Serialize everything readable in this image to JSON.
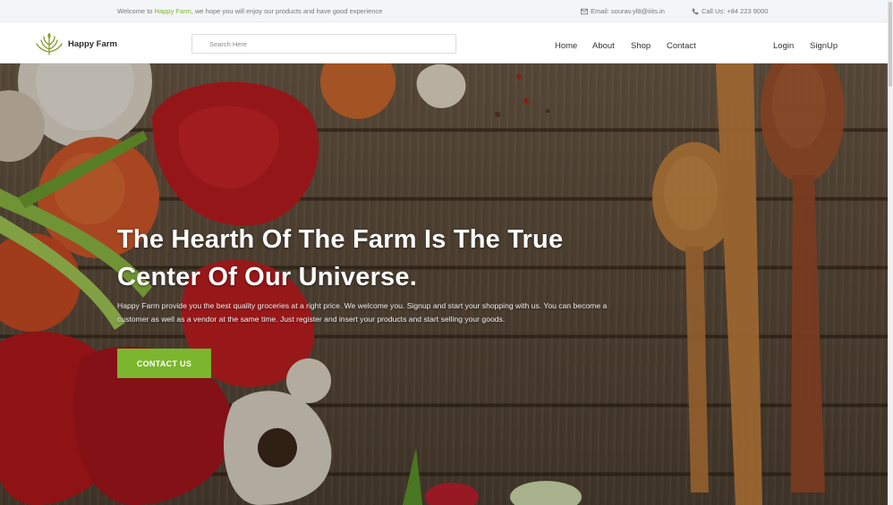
{
  "topbar": {
    "welcome_prefix": "Welcome to ",
    "welcome_brand": "Happy Farm",
    "welcome_suffix": ", we hope you will enjoy our products and have good experience",
    "email": "Email: sourav.yl8@iiits.in",
    "phone": "Call Us: +84 223 9000"
  },
  "header": {
    "logo_text": "Happy Farm",
    "search_placeholder": "Search Here",
    "nav": {
      "home": "Home",
      "about": "About",
      "shop": "Shop",
      "contact": "Contact",
      "login": "Login",
      "signup": "SignUp"
    }
  },
  "hero": {
    "title_line1": "The Hearth Of The Farm Is The True",
    "title_line2": "Center Of Our Universe.",
    "text_line1": "Happy Farm provide you the best quality groceries at a right price. We welcome you. Signup and start your shopping with us. You can become a",
    "text_line2": "customer as well as a vendor at the same time. Just register and insert your products and start selling your goods.",
    "cta_label": "CONTACT US"
  },
  "colors": {
    "accent": "#7bb62e",
    "topbar_bg": "#f4f5f7",
    "text_dark": "#333333"
  },
  "icons": {
    "logo": "wheat-icon",
    "email": "envelope-icon",
    "phone": "phone-icon"
  }
}
